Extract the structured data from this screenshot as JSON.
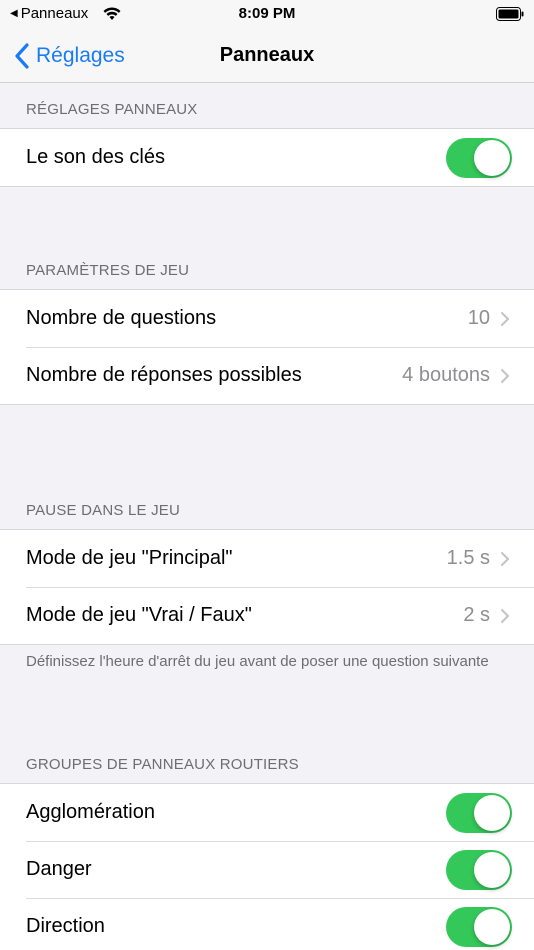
{
  "status_bar": {
    "back_app": "Panneaux",
    "time": "8:09 PM"
  },
  "nav": {
    "back_label": "Réglages",
    "title": "Panneaux"
  },
  "sections": {
    "panneaux": {
      "header": "RÉGLAGES PANNEAUX",
      "rows": [
        {
          "label": "Le son des clés",
          "toggle_on": true
        }
      ]
    },
    "jeu": {
      "header": "PARAMÈTRES DE JEU",
      "rows": [
        {
          "label": "Nombre de questions",
          "value": "10"
        },
        {
          "label": "Nombre de réponses possibles",
          "value": "4 boutons"
        }
      ]
    },
    "pause": {
      "header": "PAUSE DANS LE JEU",
      "rows": [
        {
          "label": "Mode de jeu \"Principal\"",
          "value": "1.5 s"
        },
        {
          "label": "Mode de jeu \"Vrai / Faux\"",
          "value": "2 s"
        }
      ],
      "footer": "Définissez l'heure d'arrêt du jeu avant de poser une question suivante"
    },
    "groupes": {
      "header": "GROUPES DE PANNEAUX ROUTIERS",
      "rows": [
        {
          "label": "Agglomération",
          "toggle_on": true
        },
        {
          "label": "Danger",
          "toggle_on": true
        },
        {
          "label": "Direction",
          "toggle_on": true
        }
      ]
    }
  },
  "colors": {
    "accent": "#1a7cf5",
    "toggle_on": "#34c759",
    "background": "#f2f2f7"
  }
}
